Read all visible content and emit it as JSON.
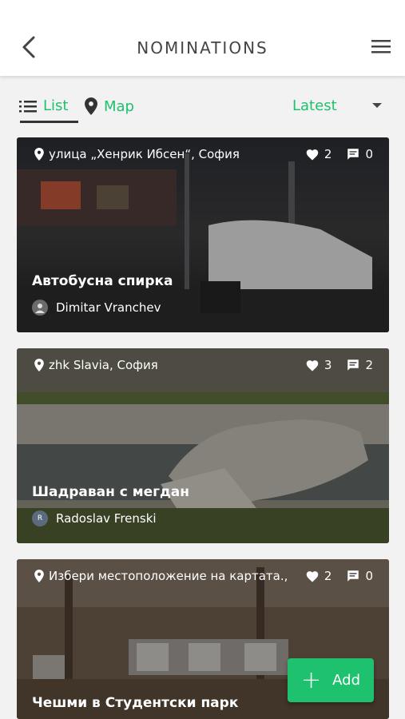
{
  "header": {
    "title": "NOMINATIONS"
  },
  "toolbar": {
    "list_label": "List",
    "map_label": "Map",
    "sort_label": "Latest"
  },
  "accent": "#1ec16d",
  "nominations": [
    {
      "location": "улица „Хенрик Ибсен“, София",
      "likes": "2",
      "comments": "0",
      "title": "Автобусна спирка",
      "author": "Dimitar Vranchev",
      "avatar": "",
      "image": "bus stop with parked white car"
    },
    {
      "location": "zhk Slavia, София",
      "likes": "3",
      "comments": "2",
      "title": "Шадраван с мегдан",
      "author": "Radoslav Frenski",
      "avatar": "R",
      "image": "broken stone fountain"
    },
    {
      "location": "Избери местоположение на картата.,",
      "likes": "2",
      "comments": "0",
      "title": "Чешми в Студентски парк",
      "author": "",
      "avatar": "",
      "image": "park with stone blocks"
    }
  ],
  "fab": {
    "label": "Add"
  }
}
